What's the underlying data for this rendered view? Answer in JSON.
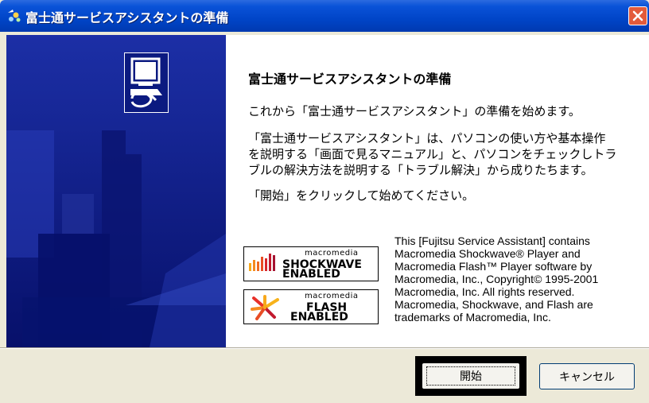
{
  "window": {
    "title": "富士通サービスアシスタントの準備",
    "close_icon": "close-icon",
    "title_icon": "setup-icon"
  },
  "banner": {
    "icon": "computer-setup-icon"
  },
  "content": {
    "heading": "富士通サービスアシスタントの準備",
    "paragraph1": "これから「富士通サービスアシスタント」の準備を始めます。",
    "paragraph2_line1": "「富士通サービスアシスタント」は、パソコンの使い方や基本操作",
    "paragraph2_line2": "を説明する「画面で見るマニュアル」と、パソコンをチェックしトラ",
    "paragraph2_line3": "ブルの解決方法を説明する「トラブル解決」から成りたちます。",
    "paragraph3": "「開始」をクリックして始めてください。"
  },
  "logos": {
    "shockwave": {
      "small": "macromedia",
      "line1": "SHOCKWAVE",
      "line2": "ENABLED"
    },
    "flash": {
      "small": "macromedia",
      "line1": "FLASH",
      "line2": "ENABLED"
    }
  },
  "license_lines": [
    "This [Fujitsu Service Assistant] contains",
    "Macromedia Shockwave® Player and",
    "Macromedia Flash™  Player software by",
    "Macromedia, Inc., Copyright© 1995-2001",
    "Macromedia, Inc. All rights reserved.",
    "Macromedia, Shockwave, and Flash are",
    "trademarks of Macromedia, Inc."
  ],
  "buttons": {
    "start": "開始",
    "cancel": "キャンセル"
  },
  "colors": {
    "titlebar": "#0a52d8",
    "banner": "#0b1a80",
    "dialog": "#ece9d8"
  }
}
